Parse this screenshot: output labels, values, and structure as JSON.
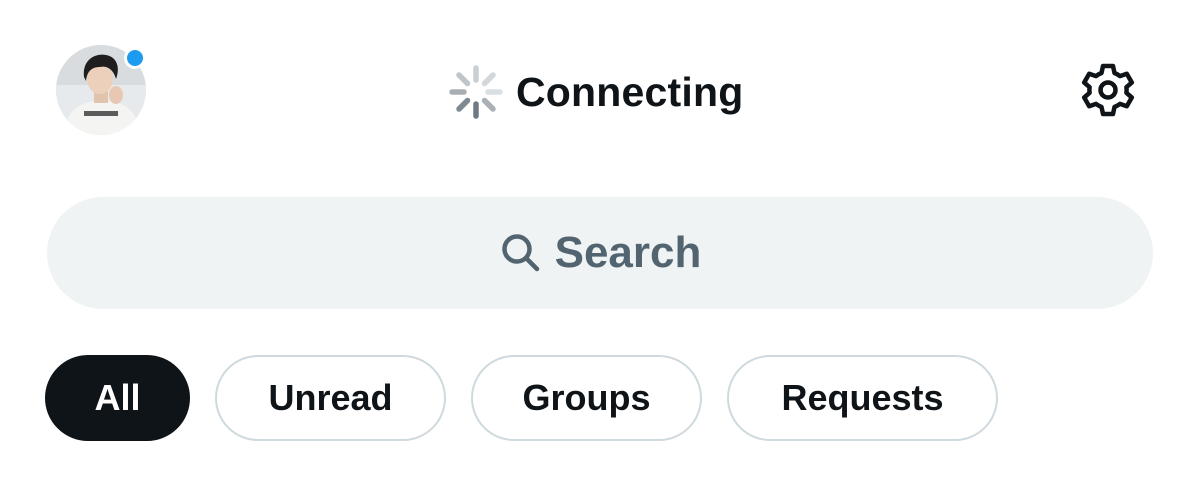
{
  "header": {
    "avatar_icon": "profile-photo",
    "presence_color": "#1d9bf0",
    "status_icon": "loading-spinner-icon",
    "status_text": "Connecting",
    "settings_icon": "gear-icon"
  },
  "search": {
    "icon": "search-icon",
    "placeholder": "Search"
  },
  "filters": {
    "active": "All",
    "items": [
      {
        "label": "All"
      },
      {
        "label": "Unread"
      },
      {
        "label": "Groups"
      },
      {
        "label": "Requests"
      }
    ]
  },
  "colors": {
    "text_primary": "#0f1419",
    "text_secondary": "#536471",
    "search_bg": "#eff3f4",
    "chip_border": "#cfd9de",
    "accent": "#1d9bf0"
  }
}
